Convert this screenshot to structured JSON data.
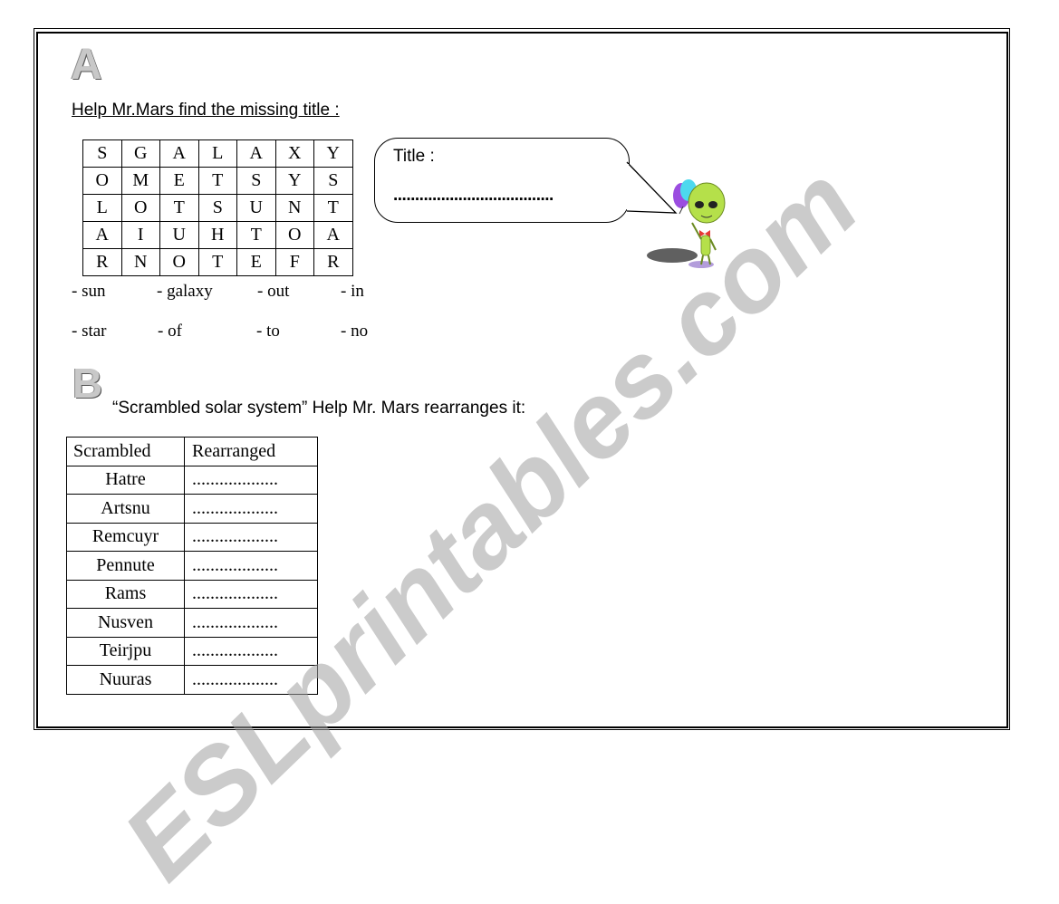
{
  "section_a": {
    "letter": "A",
    "heading": "Help Mr.Mars find the missing title :",
    "grid": [
      [
        "S",
        "G",
        "A",
        "L",
        "A",
        "X",
        "Y"
      ],
      [
        "O",
        "M",
        "E",
        "T",
        "S",
        "Y",
        "S"
      ],
      [
        "L",
        "O",
        "T",
        "S",
        "U",
        "N",
        "T"
      ],
      [
        "A",
        "I",
        "U",
        "H",
        "T",
        "O",
        "A"
      ],
      [
        "R",
        "N",
        "O",
        "T",
        "E",
        "F",
        "R"
      ]
    ],
    "word_bank": [
      [
        "- sun",
        "- galaxy",
        "- out",
        "- in"
      ],
      [
        "- star",
        "- of",
        "- to",
        "- no"
      ]
    ],
    "speech_bubble": {
      "label": "Title :",
      "answer_blank": "....................................."
    }
  },
  "section_b": {
    "letter": "B",
    "heading": "“Scrambled solar system” Help Mr. Mars rearranges it:",
    "table": {
      "headers": [
        "Scrambled",
        "Rearranged"
      ],
      "rows": [
        [
          "Hatre",
          "..................."
        ],
        [
          "Artsnu",
          "..................."
        ],
        [
          "Remcuyr",
          "..................."
        ],
        [
          "Pennute",
          "..................."
        ],
        [
          "Rams",
          "..................."
        ],
        [
          "Nusven",
          "..................."
        ],
        [
          "Teirjpu",
          "..................."
        ],
        [
          "Nuuras",
          "..................."
        ]
      ]
    }
  },
  "watermark": "ESLprintables.com"
}
